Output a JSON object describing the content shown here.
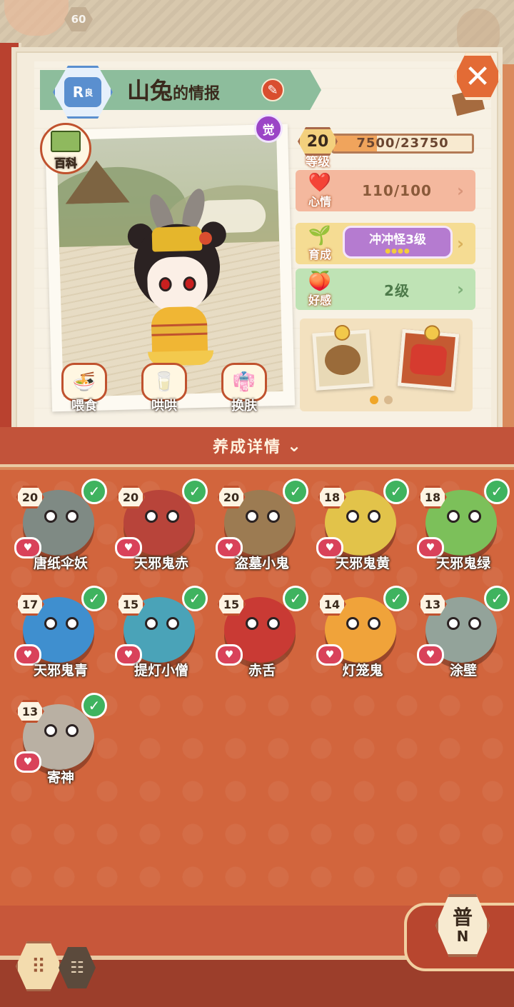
{
  "top": {
    "level_badge": "60"
  },
  "header": {
    "rarity_letter": "R",
    "rarity_label": "良",
    "name": "山兔",
    "title_suffix": "的情报",
    "awaken_label": "觉"
  },
  "character_actions": {
    "encyclopedia_label": "百科",
    "feed_label": "喂食",
    "coax_label": "哄哄",
    "skin_label": "换肤"
  },
  "stats": {
    "level": "20",
    "level_label": "等级",
    "exp_text": "7500/23750",
    "exp_progress": 0.316,
    "mood_label": "心情",
    "mood_value": "110/100",
    "growth_label": "育成",
    "growth_value": "冲冲怪3级",
    "growth_stars": "●●●●",
    "affinity_label": "好感",
    "affinity_value": "2级"
  },
  "gifts": {
    "items": [
      "food-bowl",
      "daruma-doll"
    ],
    "page_current": 1,
    "page_total": 2
  },
  "section": {
    "title": "养成详情",
    "chevron": "⌄"
  },
  "monsters": [
    {
      "name": "唐纸伞妖",
      "level": "20",
      "color": "#7f8a84"
    },
    {
      "name": "天邪鬼赤",
      "level": "20",
      "color": "#b8443a"
    },
    {
      "name": "盗墓小鬼",
      "level": "20",
      "color": "#9c7b52"
    },
    {
      "name": "天邪鬼黄",
      "level": "18",
      "color": "#e2c34a"
    },
    {
      "name": "天邪鬼绿",
      "level": "18",
      "color": "#7cc05a"
    },
    {
      "name": "天邪鬼青",
      "level": "17",
      "color": "#3f8fcf"
    },
    {
      "name": "提灯小僧",
      "level": "15",
      "color": "#4aa3b8"
    },
    {
      "name": "赤舌",
      "level": "15",
      "color": "#c93a34"
    },
    {
      "name": "灯笼鬼",
      "level": "14",
      "color": "#f0a33a"
    },
    {
      "name": "涂壁",
      "level": "13",
      "color": "#93a39a"
    },
    {
      "name": "寄神",
      "level": "13",
      "color": "#b9b0a3"
    }
  ],
  "bottom": {
    "grid_icon": "⠿",
    "list_icon": "☷",
    "rarity_filter_big": "普",
    "rarity_filter_small": "N"
  },
  "icons": {
    "close": "✕",
    "edit": "✎",
    "check": "✓",
    "heart": "♥",
    "arrow": "›"
  }
}
